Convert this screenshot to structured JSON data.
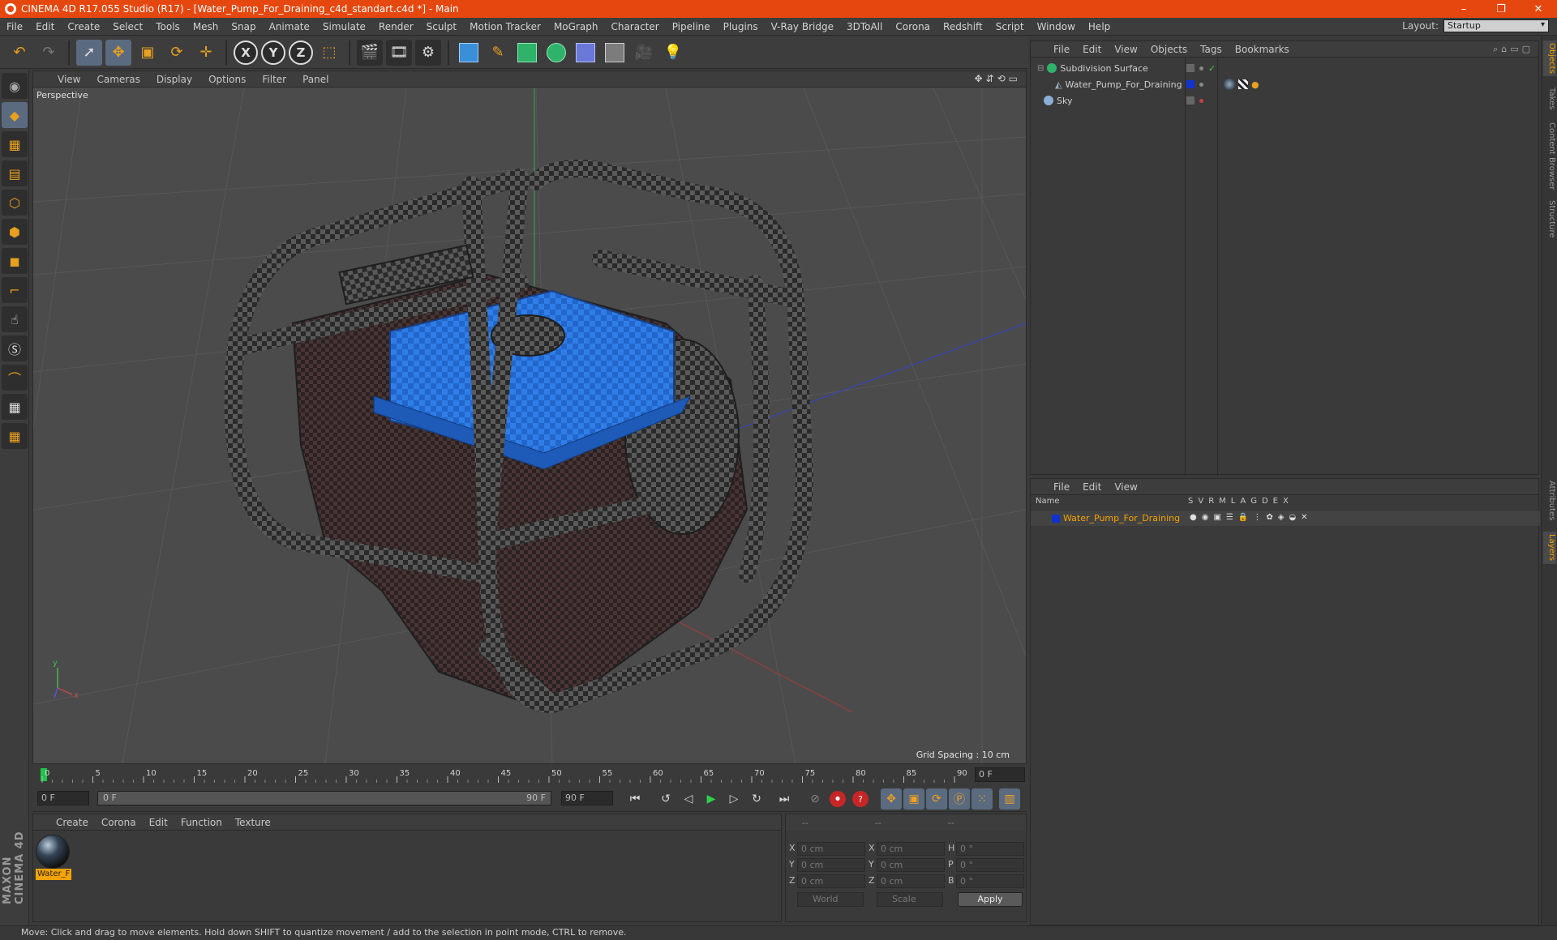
{
  "window": {
    "title": "CINEMA 4D R17.055 Studio (R17) - [Water_Pump_For_Draining_c4d_standart.c4d *] - Main",
    "minimize": "–",
    "maximize": "❐",
    "close": "✕"
  },
  "menu": [
    "File",
    "Edit",
    "Create",
    "Select",
    "Tools",
    "Mesh",
    "Snap",
    "Animate",
    "Simulate",
    "Render",
    "Sculpt",
    "Motion Tracker",
    "MoGraph",
    "Character",
    "Pipeline",
    "Plugins",
    "V-Ray Bridge",
    "3DToAll",
    "Corona",
    "Redshift",
    "Script",
    "Window",
    "Help"
  ],
  "layout": {
    "label": "Layout:",
    "value": "Startup"
  },
  "toolbar": {
    "axes": [
      "X",
      "Y",
      "Z"
    ]
  },
  "viewport": {
    "menu": [
      "View",
      "Cameras",
      "Display",
      "Options",
      "Filter",
      "Panel"
    ],
    "camera_label": "Perspective",
    "grid_spacing": "Grid Spacing : 10 cm",
    "axis_y": "y",
    "axis_x": "x",
    "colors": {
      "object_blue": "#2f7ee8",
      "checker_dark": "#2a2a2a",
      "checker_light": "#5a5a5a"
    }
  },
  "timeline": {
    "ticks": [
      "0",
      "5",
      "10",
      "15",
      "20",
      "25",
      "30",
      "35",
      "40",
      "45",
      "50",
      "55",
      "60",
      "65",
      "70",
      "75",
      "80",
      "85",
      "90"
    ],
    "current_frame": "0 F"
  },
  "transport": {
    "start_field": "0 F",
    "slider_left": "0 F",
    "slider_right": "90 F",
    "end_field": "90 F"
  },
  "materials": {
    "menu": [
      "Create",
      "Corona",
      "Edit",
      "Function",
      "Texture"
    ],
    "items": [
      {
        "label": "Water_F"
      }
    ]
  },
  "coords": {
    "headers": [
      "--",
      "--",
      "--"
    ],
    "rows": [
      {
        "l1": "X",
        "v1": "0 cm",
        "l2": "X",
        "v2": "0 cm",
        "l3": "H",
        "v3": "0 °"
      },
      {
        "l1": "Y",
        "v1": "0 cm",
        "l2": "Y",
        "v2": "0 cm",
        "l3": "P",
        "v3": "0 °"
      },
      {
        "l1": "Z",
        "v1": "0 cm",
        "l2": "Z",
        "v2": "0 cm",
        "l3": "B",
        "v3": "0 °"
      }
    ],
    "space_select": "World",
    "mode_select": "Scale",
    "apply_label": "Apply"
  },
  "status_text": "Move: Click and drag to move elements. Hold down SHIFT to quantize movement / add to the selection in point mode, CTRL to remove.",
  "object_manager": {
    "menu": [
      "File",
      "Edit",
      "View",
      "Objects",
      "Tags",
      "Bookmarks"
    ],
    "objects": [
      {
        "name": "Subdivision Surface"
      },
      {
        "name": "Water_Pump_For_Draining"
      },
      {
        "name": "Sky"
      }
    ]
  },
  "layer_manager": {
    "menu": [
      "File",
      "Edit",
      "View"
    ],
    "header_name": "Name",
    "columns": [
      "S",
      "V",
      "R",
      "M",
      "L",
      "A",
      "G",
      "D",
      "E",
      "X"
    ],
    "layers": [
      {
        "name": "Water_Pump_For_Draining",
        "color": "#1133cc"
      }
    ]
  },
  "right_tabs": [
    "Objects",
    "Takes",
    "Content Browser",
    "Structure",
    "Attributes",
    "Layers"
  ]
}
